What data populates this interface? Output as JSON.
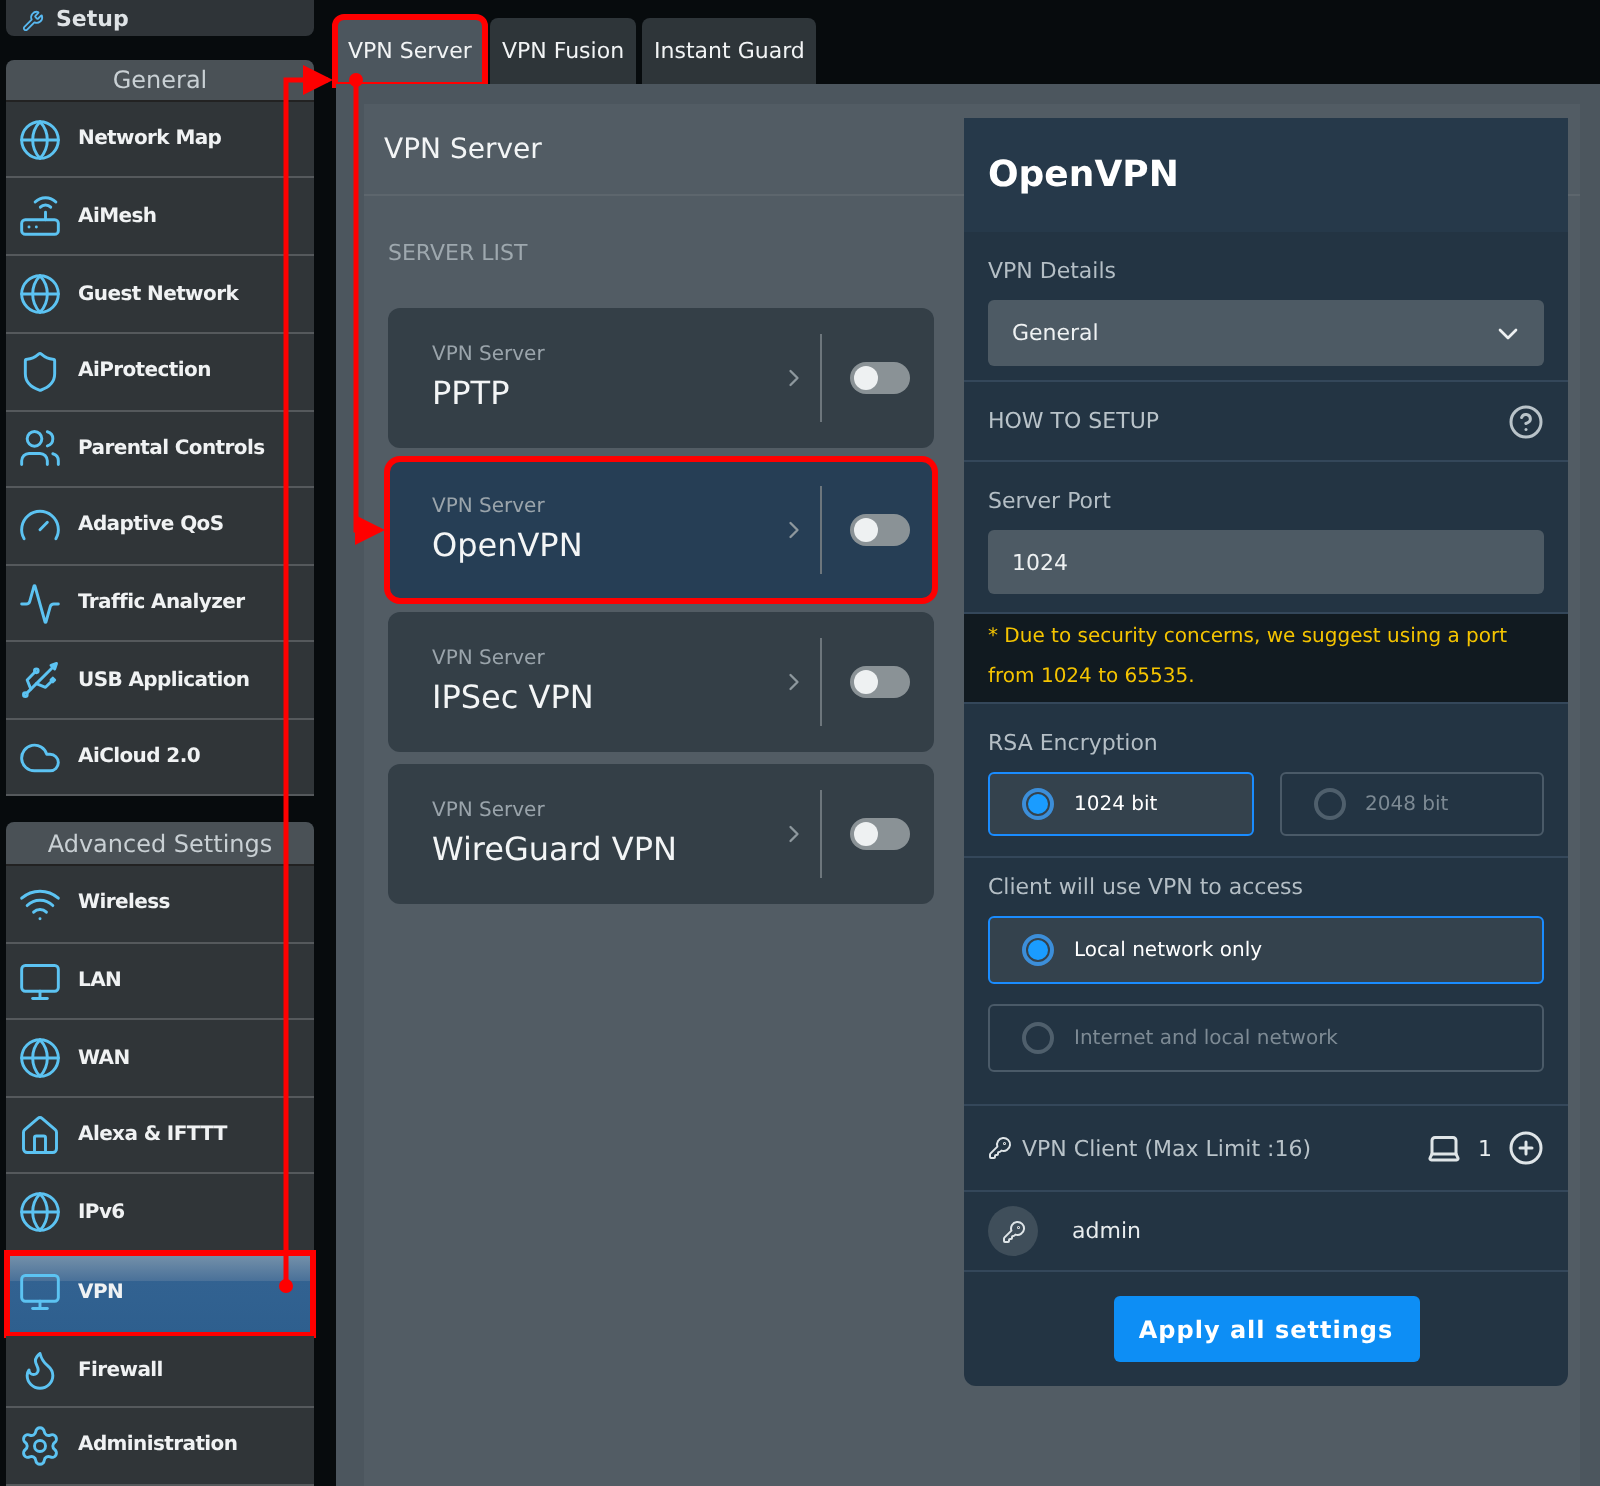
{
  "sidebar": {
    "setup": "Setup",
    "sections": [
      {
        "title": "General",
        "items": [
          {
            "label": "Network Map",
            "selected": false,
            "annotated": false
          },
          {
            "label": "AiMesh",
            "selected": false,
            "annotated": false
          },
          {
            "label": "Guest Network",
            "selected": false,
            "annotated": false
          },
          {
            "label": "AiProtection",
            "selected": false,
            "annotated": false
          },
          {
            "label": "Parental Controls",
            "selected": false,
            "annotated": false
          },
          {
            "label": "Adaptive QoS",
            "selected": false,
            "annotated": false
          },
          {
            "label": "Traffic Analyzer",
            "selected": false,
            "annotated": false
          },
          {
            "label": "USB Application",
            "selected": false,
            "annotated": false
          },
          {
            "label": "AiCloud 2.0",
            "selected": false,
            "annotated": false
          }
        ]
      },
      {
        "title": "Advanced Settings",
        "items": [
          {
            "label": "Wireless",
            "selected": false,
            "annotated": false
          },
          {
            "label": "LAN",
            "selected": false,
            "annotated": false
          },
          {
            "label": "WAN",
            "selected": false,
            "annotated": false
          },
          {
            "label": "Alexa & IFTTT",
            "selected": false,
            "annotated": false
          },
          {
            "label": "IPv6",
            "selected": false,
            "annotated": false
          },
          {
            "label": "VPN",
            "selected": true,
            "annotated": true
          },
          {
            "label": "Firewall",
            "selected": false,
            "annotated": false
          },
          {
            "label": "Administration",
            "selected": false,
            "annotated": false
          }
        ]
      }
    ]
  },
  "tabs": [
    {
      "label": "VPN Server",
      "selected": true,
      "annotated": true
    },
    {
      "label": "VPN Fusion",
      "selected": false,
      "annotated": false
    },
    {
      "label": "Instant Guard",
      "selected": false,
      "annotated": false
    }
  ],
  "page_title": "VPN Server",
  "server_list": {
    "heading": "SERVER LIST",
    "servers": [
      {
        "caption": "VPN Server",
        "name": "PPTP",
        "on": false,
        "selected": false,
        "annotated": false
      },
      {
        "caption": "VPN Server",
        "name": "OpenVPN",
        "on": false,
        "selected": true,
        "annotated": true
      },
      {
        "caption": "VPN Server",
        "name": "IPSec VPN",
        "on": false,
        "selected": false,
        "annotated": false
      },
      {
        "caption": "VPN Server",
        "name": "WireGuard VPN",
        "on": false,
        "selected": false,
        "annotated": false
      }
    ]
  },
  "details": {
    "title": "OpenVPN",
    "vpn_details": {
      "label": "VPN Details",
      "value": "General"
    },
    "how_to_setup": "HOW TO SETUP",
    "server_port": {
      "label": "Server Port",
      "value": "1024",
      "note": "* Due to security concerns, we suggest using a port from 1024 to 65535."
    },
    "rsa": {
      "label": "RSA Encryption",
      "options": [
        {
          "label": "1024 bit",
          "selected": true
        },
        {
          "label": "2048 bit",
          "selected": false
        }
      ]
    },
    "access": {
      "label": "Client will use VPN to access",
      "options": [
        {
          "label": "Local network only",
          "selected": true
        },
        {
          "label": "Internet and local network",
          "selected": false
        }
      ]
    },
    "clients": {
      "label": "VPN Client (Max Limit :16)",
      "count": "1",
      "users": [
        "admin"
      ]
    },
    "apply": "Apply all settings"
  }
}
